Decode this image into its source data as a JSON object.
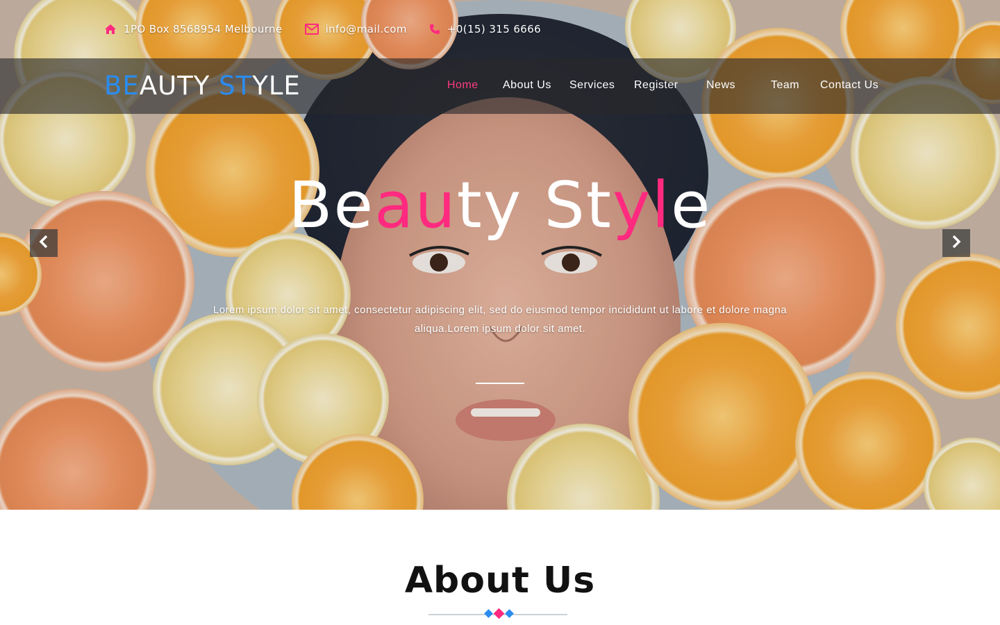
{
  "topbar": {
    "address": "1PO Box 8568954 Melbourne",
    "email": "info@mail.com",
    "phone": "+0(15) 315 6666"
  },
  "logo": {
    "part1_blue": "BE",
    "part2_white": "AUTY ",
    "part3_blue": "ST",
    "part4_white": "YLE"
  },
  "nav": {
    "items": [
      {
        "label": "Home",
        "active": true
      },
      {
        "label": "About Us"
      },
      {
        "label": "Services"
      },
      {
        "label": "Register"
      },
      {
        "label": "News"
      },
      {
        "label": "Team"
      },
      {
        "label": "Contact Us"
      }
    ]
  },
  "hero": {
    "title_parts": [
      "Be",
      "au",
      "ty St",
      "yl",
      "e"
    ],
    "text": "Lorem ipsum dolor sit amet, consectetur adipiscing elit, sed do eiusmod tempor incididunt ut labore et dolore magna aliqua.Lorem ipsum dolor sit amet.",
    "prev_icon": "chevron-left-icon",
    "next_icon": "chevron-right-icon"
  },
  "about": {
    "title": "About Us"
  },
  "colors": {
    "accent_pink": "#ff2a7f",
    "accent_blue": "#2b8cf0",
    "navbar_bg": "rgba(40,40,44,0.62)"
  }
}
